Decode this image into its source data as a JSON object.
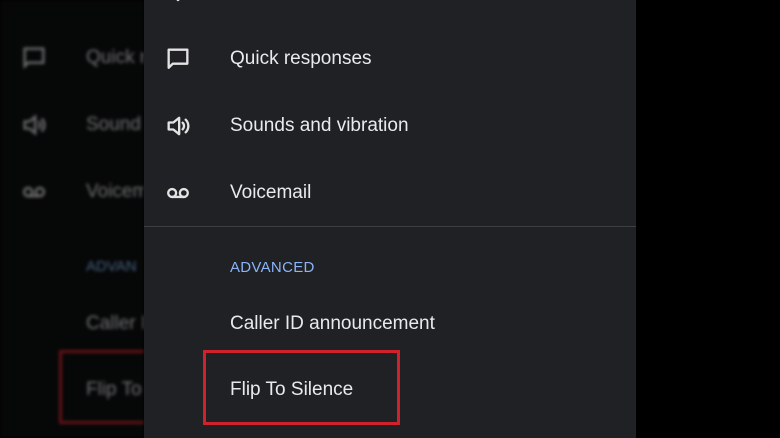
{
  "settings": {
    "items": [
      {
        "label": "Quick responses",
        "icon": "quick-responses-icon"
      },
      {
        "label": "Sounds and vibration",
        "icon": "speaker-icon"
      },
      {
        "label": "Voicemail",
        "icon": "voicemail-icon"
      }
    ],
    "advanced_header": "ADVANCED",
    "advanced_items": [
      {
        "label": "Caller ID announcement"
      },
      {
        "label": "Flip To Silence"
      }
    ]
  },
  "background": {
    "items": [
      {
        "label": "Quick r"
      },
      {
        "label": "Sound"
      },
      {
        "label": "Voicem"
      }
    ],
    "advanced_header": "ADVAN",
    "advanced_items": [
      {
        "label": "Caller I"
      },
      {
        "label": "Flip To"
      }
    ]
  },
  "colors": {
    "panel_bg": "#202124",
    "text": "#e8eaed",
    "accent": "#8ab4f8",
    "highlight": "#d0222c"
  }
}
